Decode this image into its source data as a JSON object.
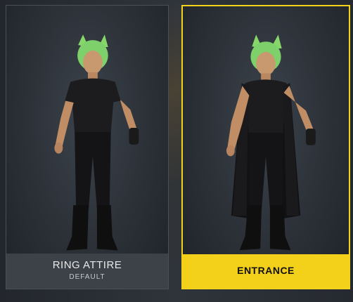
{
  "outfits": [
    {
      "title": "RING ATTIRE",
      "subtitle": "DEFAULT"
    },
    {
      "title": "ENTRANCE"
    }
  ],
  "colors": {
    "selected_accent": "#f3d01a",
    "card_label_bg": "#3d4148"
  },
  "icons": [
    "character-render-ring-attire",
    "character-render-entrance"
  ]
}
